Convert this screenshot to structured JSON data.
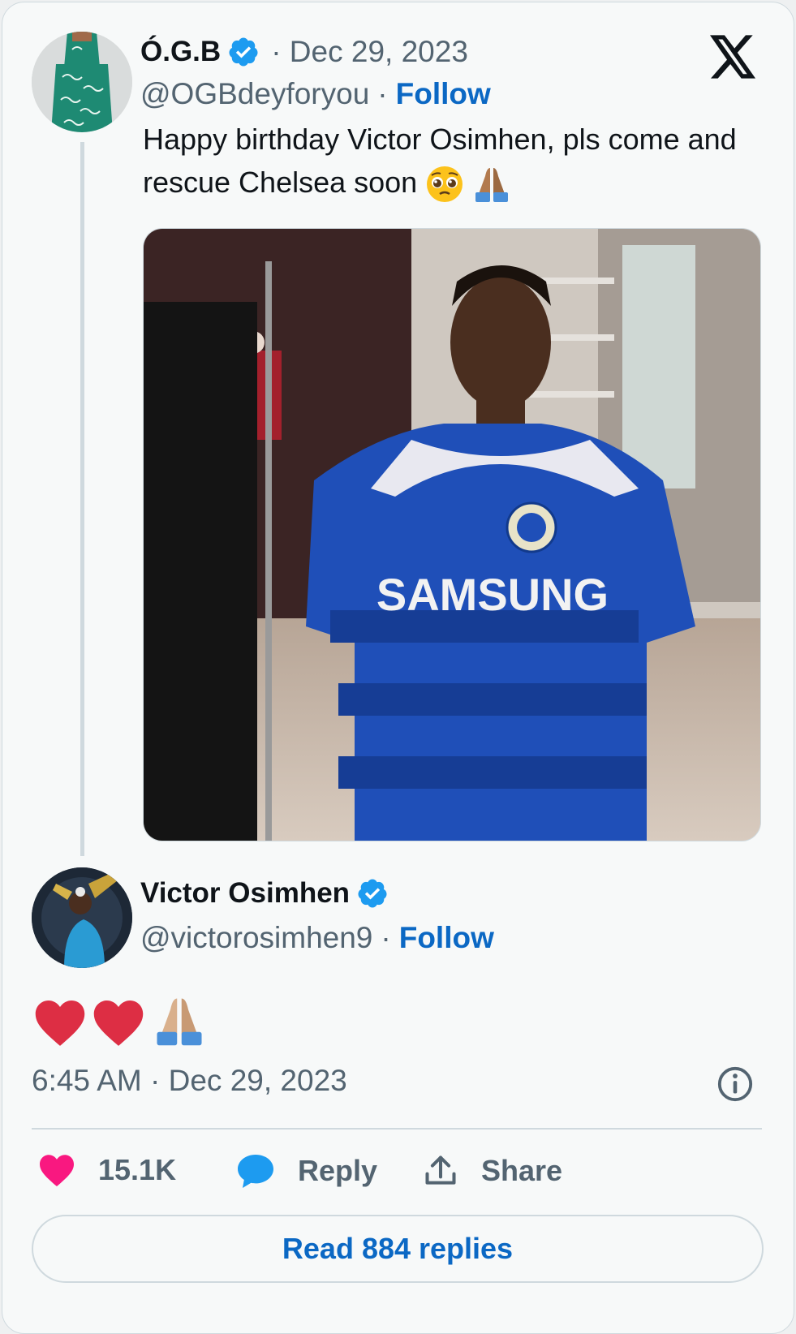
{
  "original_tweet": {
    "author_name": "Ó.G.B",
    "date": "Dec 29, 2023",
    "handle": "@OGBdeyforyou",
    "follow_label": "Follow",
    "text": "Happy birthday Victor Osimhen, pls come and rescue Chelsea soon",
    "text_emojis": [
      "pleading-face",
      "folded-hands"
    ],
    "image_description_text": "SAMSUNG"
  },
  "reply_tweet": {
    "author_name": "Victor Osimhen",
    "handle": "@victorosimhen9",
    "follow_label": "Follow",
    "content_emojis": [
      "red-heart",
      "red-heart",
      "folded-hands"
    ],
    "timestamp": "6:45 AM · Dec 29, 2023"
  },
  "actions": {
    "likes_count": "15.1K",
    "reply_label": "Reply",
    "share_label": "Share"
  },
  "read_replies_label": "Read 884 replies",
  "colors": {
    "accent": "#0b68c4",
    "verified": "#1d9bf0",
    "like": "#f91880",
    "text_gray": "#536471"
  }
}
